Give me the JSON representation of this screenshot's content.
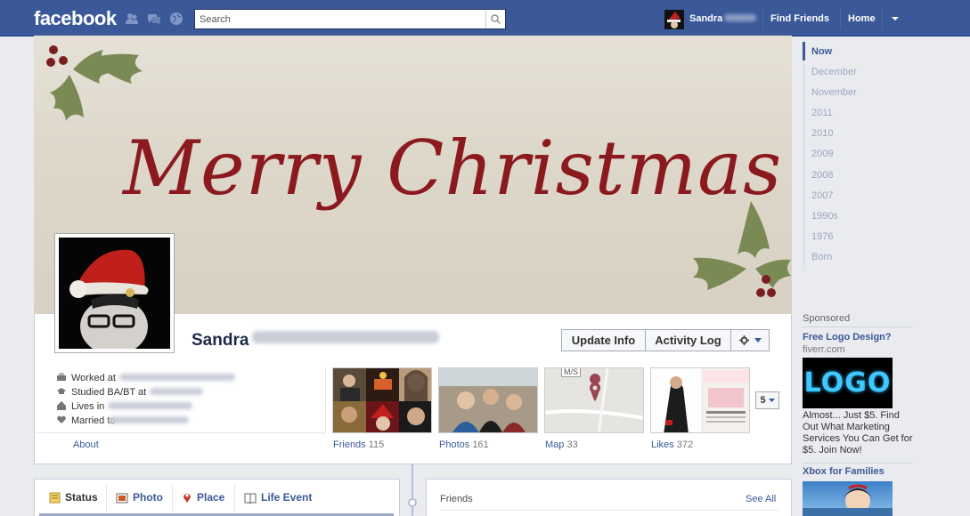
{
  "topbar": {
    "logo": "facebook",
    "search_placeholder": "Search",
    "user_name": "Sandra",
    "find_friends": "Find Friends",
    "home": "Home",
    "brand_color": "#3b5998"
  },
  "cover": {
    "text": "Merry Christmas",
    "text_color": "#8b1a1f"
  },
  "profile": {
    "name": "Sandra",
    "update_info": "Update Info",
    "activity_log": "Activity Log"
  },
  "about": {
    "lines": [
      {
        "icon": "briefcase-icon",
        "text": "Worked at"
      },
      {
        "icon": "graduation-cap-icon",
        "text": "Studied BA/BT at"
      },
      {
        "icon": "house-icon",
        "text": "Lives in"
      },
      {
        "icon": "heart-icon",
        "text": "Married to"
      }
    ],
    "link": "About"
  },
  "apps": [
    {
      "label": "Friends",
      "count": "115"
    },
    {
      "label": "Photos",
      "count": "161"
    },
    {
      "label": "Map",
      "count": "33"
    },
    {
      "label": "Likes",
      "count": "372"
    }
  ],
  "map_tag": "M/S",
  "more_count": "5",
  "composer": {
    "items": [
      {
        "icon": "status-icon",
        "label": "Status"
      },
      {
        "icon": "photo-icon",
        "label": "Photo"
      },
      {
        "icon": "place-pin-icon",
        "label": "Place"
      },
      {
        "icon": "life-event-icon",
        "label": "Life Event"
      }
    ]
  },
  "friends_box": {
    "title": "Friends",
    "see_all": "See All"
  },
  "timeline_years": [
    "Now",
    "December",
    "November",
    "2011",
    "2010",
    "2009",
    "2008",
    "2007",
    "1990s",
    "1976",
    "Born"
  ],
  "sponsored": {
    "heading": "Sponsored",
    "ads": [
      {
        "title": "Free Logo Design?",
        "domain": "fiverr.com",
        "image_text": "LOGO",
        "body": "Almost... Just $5. Find Out What Marketing Services You Can Get for $5. Join Now!"
      },
      {
        "title": "Xbox for Families"
      }
    ]
  }
}
